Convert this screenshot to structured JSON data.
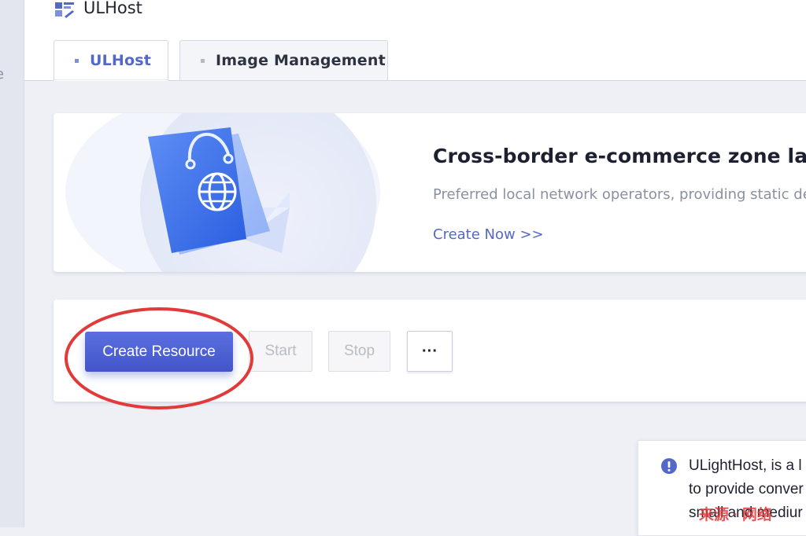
{
  "app": {
    "title": "ULHost"
  },
  "tabs": [
    {
      "label": "ULHost",
      "active": true
    },
    {
      "label": "Image Management",
      "active": false
    }
  ],
  "left_rail": {
    "clipped_text": "e"
  },
  "banner": {
    "title": "Cross-border e-commerce zone lands st",
    "subtitle": "Preferred local network operators, providing static ded",
    "link": "Create Now >>",
    "art_icon": "shopping-bag-globe-icon"
  },
  "toolbar": {
    "create": "Create Resource",
    "start": "Start",
    "stop": "Stop",
    "more": "···"
  },
  "notice": {
    "line1": "ULightHost, is a l",
    "line2": "to provide conver",
    "line3": "small and mediur"
  },
  "watermark": {
    "text": "来源 · 网络"
  },
  "colors": {
    "accent": "#5468c9",
    "primary_button": "#4a5cd0",
    "annotation_red": "#e23a3a",
    "background": "#eef0f6"
  }
}
